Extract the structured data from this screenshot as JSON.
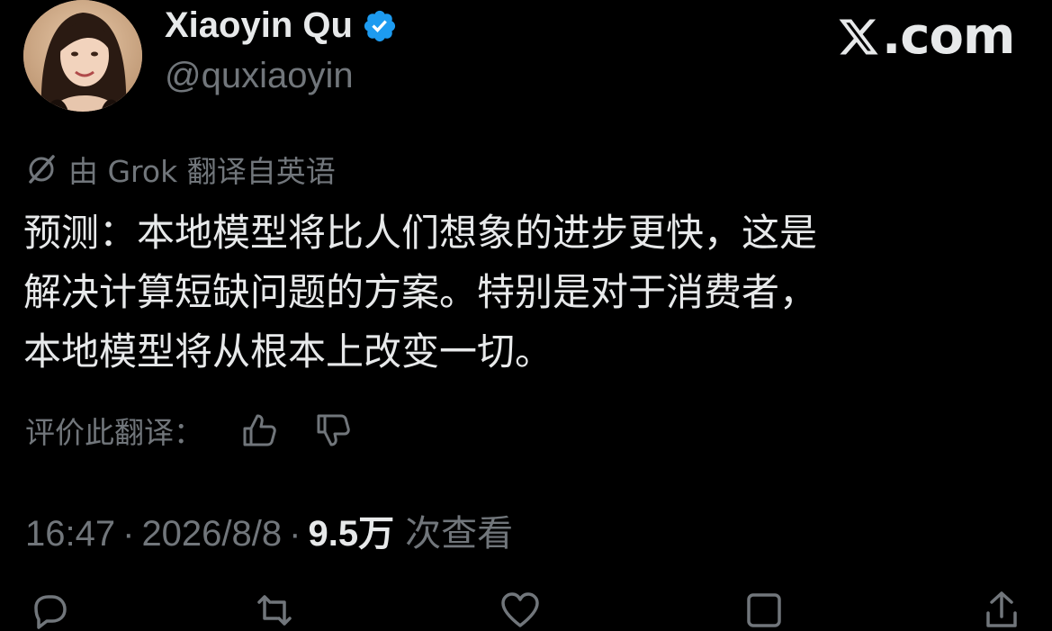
{
  "author": {
    "display_name": "Xiaoyin Qu",
    "handle": "@quxiaoyin",
    "verified_icon": "verified-badge-icon"
  },
  "site": {
    "logo_text": ".com",
    "logo_icon": "x-logo-icon"
  },
  "translation": {
    "note": "由 Grok 翻译自英语",
    "icon": "grok-icon"
  },
  "tweet": {
    "lines": [
      "预测：本地模型将比人们想象的进步更快，这是",
      "解决计算短缺问题的方案。特别是对于消费者，",
      "本地模型将从根本上改变一切。"
    ]
  },
  "rating": {
    "label": "评价此翻译：",
    "up_icon": "thumbs-up-icon",
    "down_icon": "thumbs-down-icon"
  },
  "meta": {
    "time": "16:47",
    "separator": "·",
    "date": "2026/8/8",
    "views": "9.5万",
    "views_label": "次查看"
  },
  "actions": {
    "reply_icon": "reply-icon",
    "repost_icon": "repost-icon",
    "like_icon": "like-icon",
    "bookmark_icon": "bookmark-icon",
    "share_icon": "share-icon"
  },
  "colors": {
    "background": "#000000",
    "primary_text": "#e7e9ea",
    "secondary_text": "#71767b",
    "verified_blue": "#1d9bf0"
  }
}
